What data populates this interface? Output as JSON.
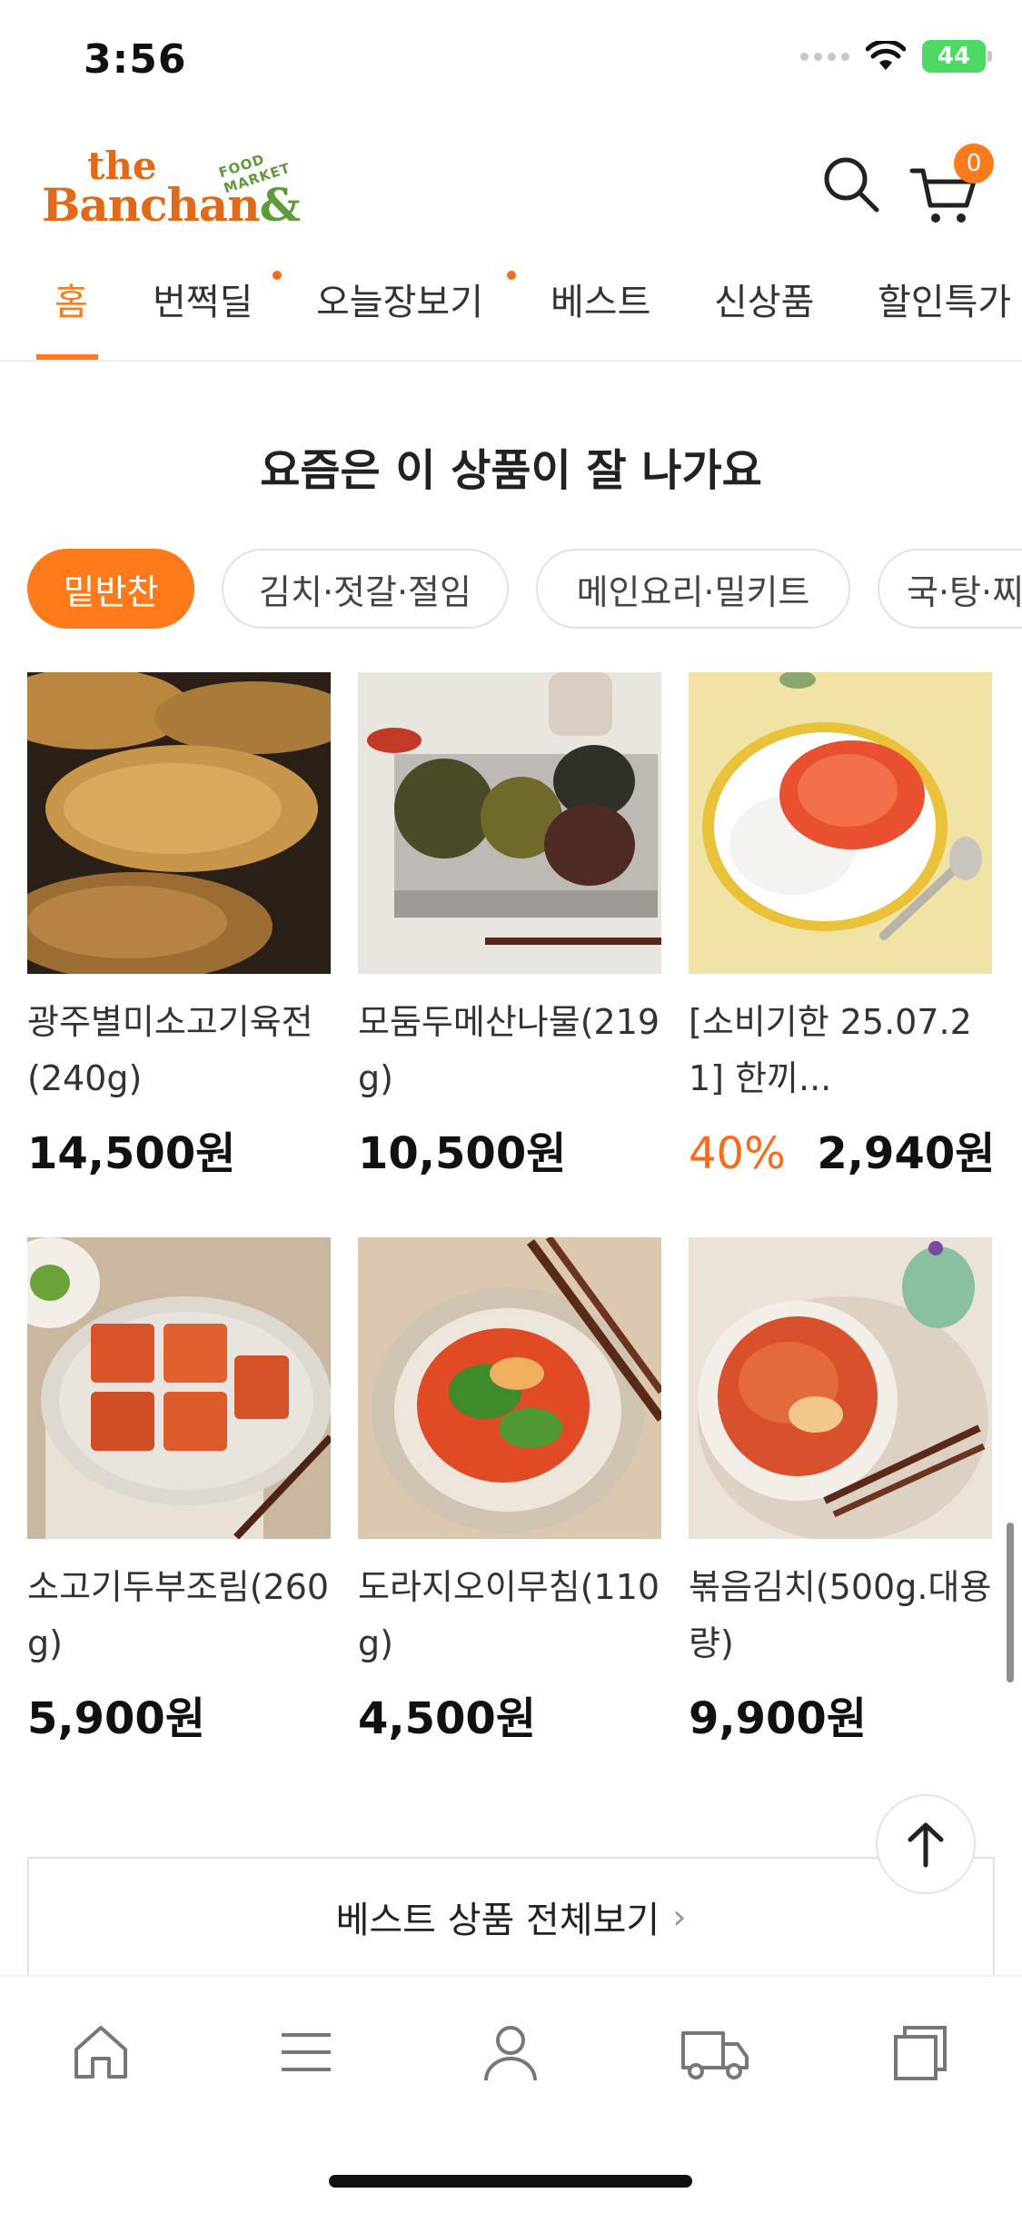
{
  "status_bar": {
    "time": "3:56",
    "battery": "44"
  },
  "header": {
    "logo": {
      "the": "the",
      "banchan": "Banchan",
      "amp": "&",
      "food_market": "FOOD MARKET"
    },
    "cart_count": "0",
    "icons": [
      "search-icon",
      "cart-icon"
    ]
  },
  "nav": {
    "tabs": [
      {
        "label": "홈",
        "active": true,
        "dot": false
      },
      {
        "label": "번쩍딜",
        "active": false,
        "dot": true
      },
      {
        "label": "오늘장보기",
        "active": false,
        "dot": true
      },
      {
        "label": "베스트",
        "active": false,
        "dot": false
      },
      {
        "label": "신상품",
        "active": false,
        "dot": false
      },
      {
        "label": "할인특가",
        "active": false,
        "dot": false
      }
    ]
  },
  "section": {
    "title": "요즘은 이 상품이 잘 나가요"
  },
  "chips": [
    {
      "label": "밑반찬",
      "active": true
    },
    {
      "label": "김치·젓갈·절임",
      "active": false
    },
    {
      "label": "메인요리·밀키트",
      "active": false
    },
    {
      "label": "국·탕·찌개",
      "active": false
    }
  ],
  "products": [
    {
      "name": "광주별미소고기육전(240g)",
      "discount": "",
      "price": "14,500원"
    },
    {
      "name": "모둠두메산나물(219g)",
      "discount": "",
      "price": "10,500원"
    },
    {
      "name": "[소비기한 25.07.21] 한끼...",
      "discount": "40%",
      "price": "2,940원"
    },
    {
      "name": "소고기두부조림(260g)",
      "discount": "",
      "price": "5,900원"
    },
    {
      "name": "도라지오이무침(110g)",
      "discount": "",
      "price": "4,500원"
    },
    {
      "name": "볶음김치(500g.대용량)",
      "discount": "",
      "price": "9,900원"
    }
  ],
  "view_all": {
    "label": "베스트 상품 전체보기",
    "chevron": "›"
  },
  "bottom_bar": {
    "items": [
      "home-icon",
      "menu-icon",
      "user-icon",
      "delivery-truck-icon",
      "recent-items-icon"
    ]
  },
  "colors": {
    "accent": "#ff7a1a",
    "logo_orange": "#e06a17",
    "logo_green": "#5f9a3a",
    "battery_green": "#4cd964"
  }
}
